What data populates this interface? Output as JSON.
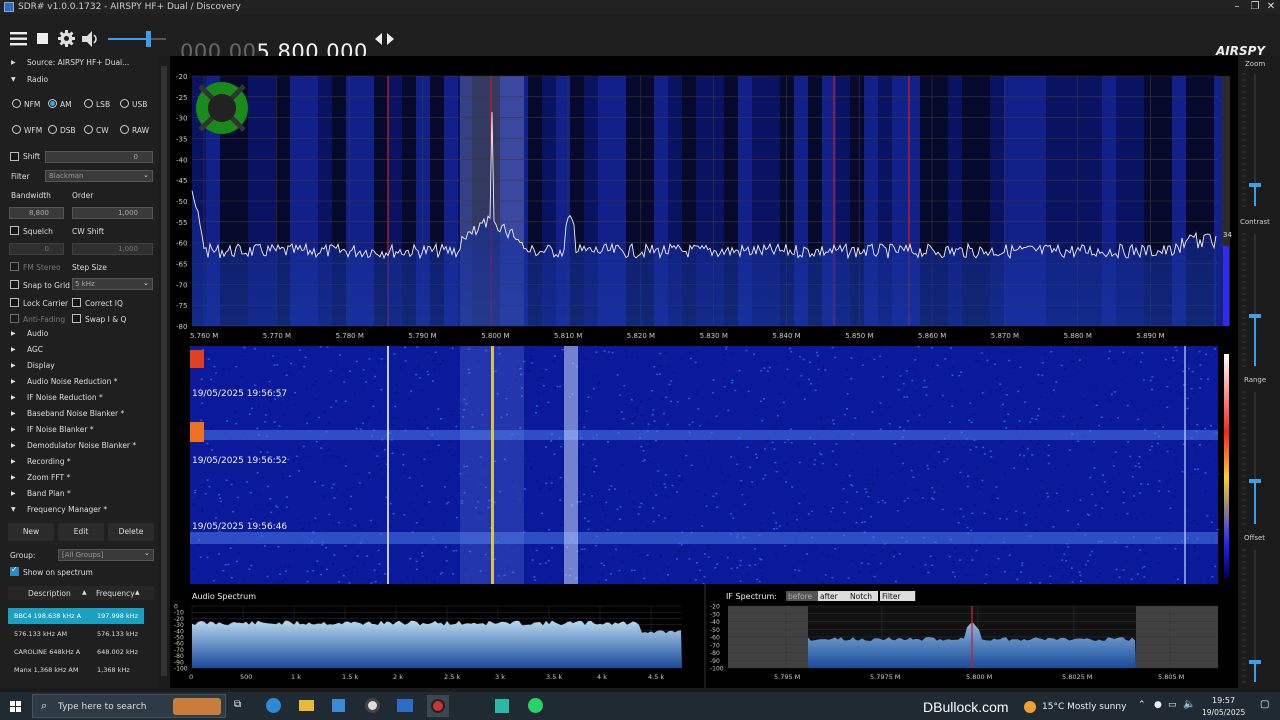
{
  "titlebar": {
    "title": "SDR# v1.0.0.1732 - AIRSPY HF+ Dual / Discovery",
    "min": "–",
    "max": "❐",
    "close": "✕"
  },
  "toolbar": {
    "freq_dim": "000.00",
    "freq_bright": "5.800.000",
    "logo": "AIRSPY"
  },
  "source": {
    "label": "Source: AIRSPY HF+ Dual..."
  },
  "radio": {
    "label": "Radio",
    "modes": [
      {
        "label": "NFM",
        "selected": false
      },
      {
        "label": "AM",
        "selected": true
      },
      {
        "label": "LSB",
        "selected": false
      },
      {
        "label": "USB",
        "selected": false
      },
      {
        "label": "WFM",
        "selected": false
      },
      {
        "label": "DSB",
        "selected": false
      },
      {
        "label": "CW",
        "selected": false
      },
      {
        "label": "RAW",
        "selected": false
      }
    ],
    "shift_label": "Shift",
    "shift_value": "0",
    "filter_label": "Filter",
    "filter_value": "Blackman",
    "bandwidth_label": "Bandwidth",
    "order_label": "Order",
    "bandwidth_value": "8,800",
    "order_value": "1,000",
    "squelch_label": "Squelch",
    "cwshift_label": "CW Shift",
    "squelch_value": "0",
    "cwshift_value": "1,000",
    "fmstereo_label": "FM Stereo",
    "stepsize_label": "Step Size",
    "snap_label": "Snap to Grid",
    "snap_value": "5 kHz",
    "lockcarrier_label": "Lock Carrier",
    "correctiq_label": "Correct IQ",
    "antifading_label": "Anti-Fading",
    "swapiq_label": "Swap I & Q"
  },
  "sections": [
    "Audio",
    "AGC",
    "Display",
    "Audio Noise Reduction *",
    "IF Noise Reduction *",
    "Baseband Noise Blanker *",
    "IF Noise Blanker *",
    "Demodulator Noise Blanker *",
    "Recording *",
    "Zoom FFT *",
    "Band Plan *",
    "Frequency Manager *"
  ],
  "freqmgr": {
    "new": "New",
    "edit": "Edit",
    "delete": "Delete",
    "group_label": "Group:",
    "group_value": "[All Groups]",
    "show_label": "Show on spectrum",
    "col_desc": "Description",
    "col_freq": "Frequency",
    "rows": [
      {
        "desc": "BBC4 198.638 kHz A",
        "freq": "197.998 kHz"
      },
      {
        "desc": "576.133 kHz AM",
        "freq": "576.133 kHz"
      },
      {
        "desc": "CAROLINE 648kHz A",
        "freq": "648.002 kHz"
      },
      {
        "desc": "Manx 1,368 kHz AM",
        "freq": "1,368 kHz"
      }
    ]
  },
  "spectrum": {
    "db_labels": [
      "-20",
      "-25",
      "-30",
      "-35",
      "-40",
      "-45",
      "-50",
      "-55",
      "-60",
      "-65",
      "-70",
      "-75",
      "-80"
    ],
    "freq_labels": [
      "5.760 M",
      "5.770 M",
      "5.780 M",
      "5.790 M",
      "5.800 M",
      "5.810 M",
      "5.820 M",
      "5.830 M",
      "5.840 M",
      "5.850 M",
      "5.860 M",
      "5.870 M",
      "5.880 M",
      "5.890 M"
    ],
    "snr_value": "34"
  },
  "waterfall": {
    "timestamps": [
      "19/05/2025 19:56:57",
      "19/05/2025 19:56:52",
      "19/05/2025 19:56:46"
    ]
  },
  "rightbar": {
    "zoom": "Zoom",
    "contrast": "Contrast",
    "range": "Range",
    "offset": "Offset"
  },
  "audio_spectrum": {
    "title": "Audio Spectrum",
    "y_labels": [
      "0",
      "-10",
      "-20",
      "-30",
      "-40",
      "-50",
      "-60",
      "-70",
      "-80",
      "-90",
      "-100"
    ],
    "x_labels": [
      "0",
      "500",
      "1 k",
      "1.5 k",
      "2 k",
      "2.5 k",
      "3 k",
      "3.5 k",
      "4 k",
      "4.5 k"
    ]
  },
  "if_spectrum": {
    "title": "IF Spectrum:",
    "tabs": [
      "before",
      "after",
      "Notch",
      "Filter"
    ],
    "y_labels": [
      "-20",
      "-30",
      "-40",
      "-50",
      "-60",
      "-70",
      "-80",
      "-90",
      "-100"
    ],
    "x_labels": [
      "5.795 M",
      "5.7975 M",
      "5.800 M",
      "5.8025 M",
      "5.805 M"
    ]
  },
  "taskbar": {
    "search_placeholder": "Type here to search",
    "watermark": "DBullock.com",
    "weather": "15°C  Mostly sunny",
    "time": "19:57",
    "date": "19/05/2025"
  }
}
